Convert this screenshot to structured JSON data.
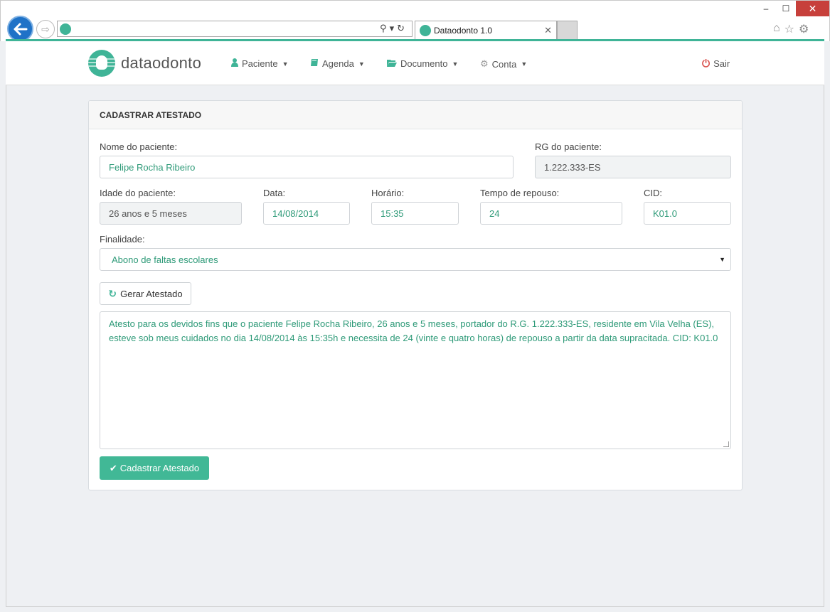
{
  "browser": {
    "tab_title": "Dataodonto 1.0",
    "address": "",
    "window_controls": {
      "minimize": "–",
      "maximize": "☐",
      "close": "✕"
    },
    "icons": [
      "home-icon",
      "star-icon",
      "gear-icon"
    ]
  },
  "navbar": {
    "brand": "dataodonto",
    "items": [
      {
        "label": "Paciente",
        "icon": "user-icon"
      },
      {
        "label": "Agenda",
        "icon": "book-icon"
      },
      {
        "label": "Documento",
        "icon": "folder-open-icon"
      },
      {
        "label": "Conta",
        "icon": "gear-icon"
      }
    ],
    "logout": "Sair"
  },
  "panel": {
    "title": "CADASTRAR ATESTADO",
    "fields": {
      "nome": {
        "label": "Nome do paciente:",
        "value": "Felipe Rocha Ribeiro"
      },
      "rg": {
        "label": "RG do paciente:",
        "value": "1.222.333-ES"
      },
      "idade": {
        "label": "Idade do paciente:",
        "value": "26 anos e 5 meses"
      },
      "data": {
        "label": "Data:",
        "value": "14/08/2014"
      },
      "horario": {
        "label": "Horário:",
        "value": "15:35"
      },
      "repouso": {
        "label": "Tempo de repouso:",
        "value": "24"
      },
      "cid": {
        "label": "CID:",
        "value": "K01.0"
      },
      "finalidade": {
        "label": "Finalidade:",
        "value": "Abono de faltas escolares"
      }
    },
    "generate_button": "Gerar Atestado",
    "certificate_text": "Atesto para os devidos fins que o paciente Felipe Rocha Ribeiro, 26 anos e 5 meses, portador do R.G. 1.222.333-ES, residente em Vila Velha (ES), esteve sob meus cuidados no dia 14/08/2014 às 15:35h e necessita de 24 (vinte e quatro horas) de repouso a partir da data supracitada. CID: K01.0",
    "save_button": "Cadastrar Atestado"
  },
  "colors": {
    "accent": "#3fb497",
    "value_text": "#2e9a78",
    "logout": "#d9534f",
    "close_button": "#c7403b"
  }
}
